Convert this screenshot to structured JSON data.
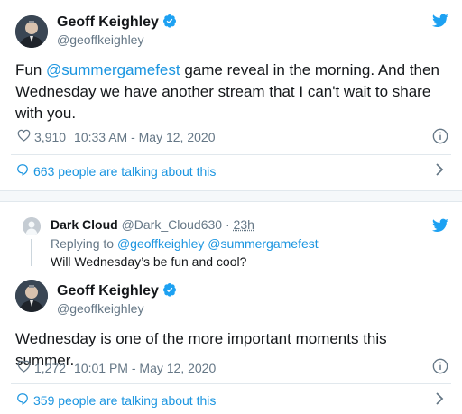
{
  "tweet1": {
    "name": "Geoff Keighley",
    "handle": "@geoffkeighley",
    "text_before": "Fun ",
    "mention": "@summergamefest",
    "text_after": " game reveal in the morning.  And then Wednesday we have another stream that I can't wait to share with you.",
    "likes": "3,910",
    "timestamp": "10:33 AM - May 12, 2020",
    "talking": "663 people are talking about this"
  },
  "reply_context": {
    "name": "Dark Cloud",
    "handle": "@Dark_Cloud630",
    "dot": "·",
    "time": "23h",
    "replying_label": "Replying to",
    "replying_to": "@geoffkeighley @summergamefest",
    "text": "Will Wednesday’s be fun and cool?"
  },
  "tweet2": {
    "name": "Geoff Keighley",
    "handle": "@geoffkeighley",
    "text": "Wednesday is one of the more important moments this summer.",
    "likes": "1,272",
    "timestamp": "10:01 PM - May 12, 2020",
    "talking": "359 people are talking about this"
  },
  "icons": {
    "brand": "twitter-bird-icon",
    "verified": "verified-badge-icon",
    "like": "heart-icon",
    "info": "info-icon",
    "talk": "speech-bubble-icon",
    "chevron": "chevron-right-icon"
  },
  "colors": {
    "accent": "#1b95e0",
    "bird": "#1da1f2",
    "muted": "#657786",
    "text": "#14171a"
  }
}
